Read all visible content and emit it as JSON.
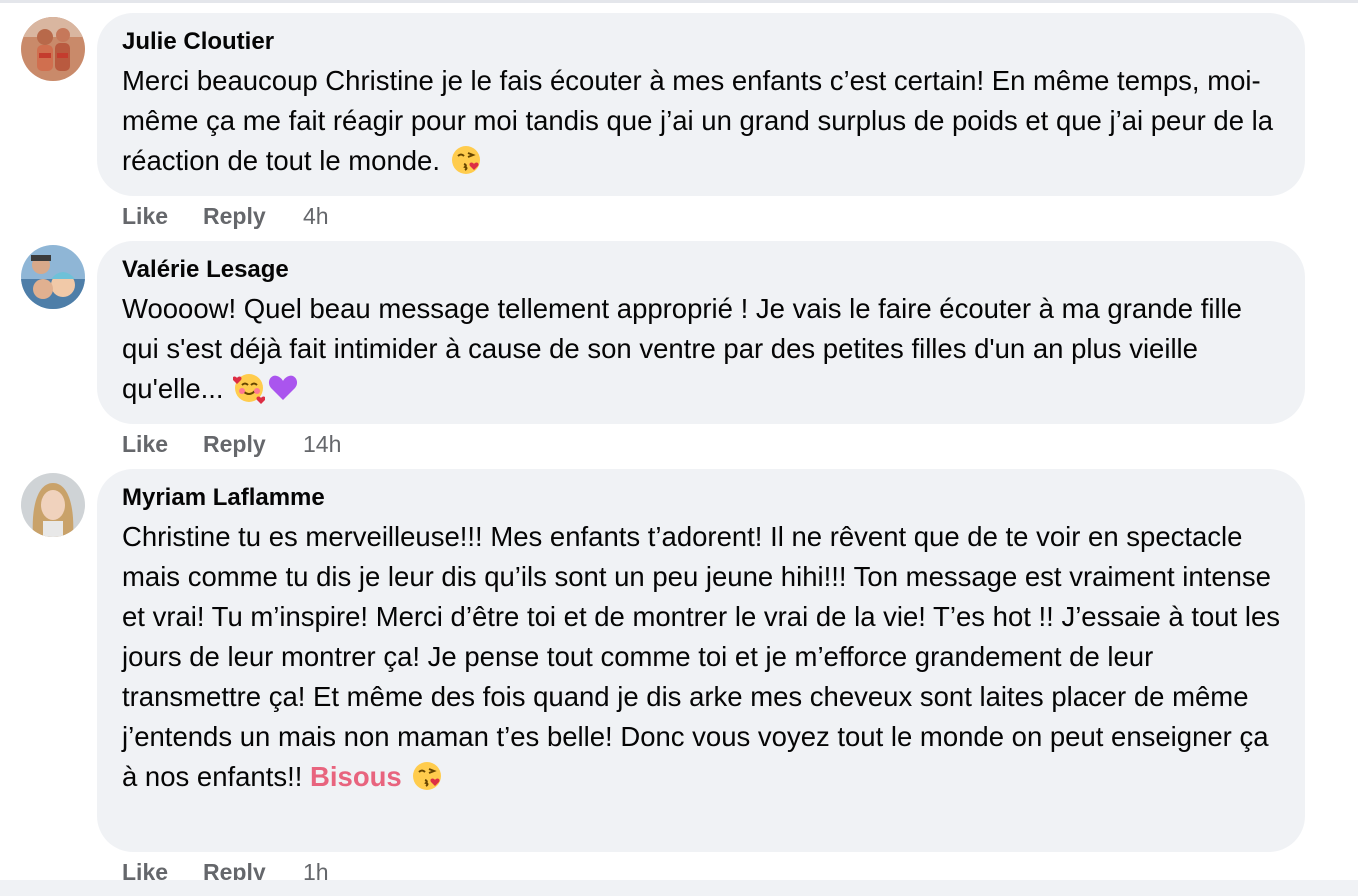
{
  "comments": [
    {
      "author": "Julie Cloutier",
      "text": "Merci beaucoup Christine je le fais écouter à mes enfants c’est certain! En même temps, moi-même ça me fait réagir pour moi tandis que j’ai un grand surplus de poids et que j’ai peur de la réaction de tout le monde.",
      "emojis": [
        "kissing-heart-emoji"
      ],
      "like_label": "Like",
      "reply_label": "Reply",
      "time": "4h"
    },
    {
      "author": "Valérie Lesage",
      "text": "Woooow! Quel beau message tellement approprié ! Je vais le faire écouter à ma grande fille qui s'est déjà fait intimider à cause de son ventre par des petites filles d'un an plus vieille qu'elle...",
      "emojis": [
        "smiling-hearts-emoji",
        "purple-heart-emoji"
      ],
      "like_label": "Like",
      "reply_label": "Reply",
      "time": "14h"
    },
    {
      "author": "Myriam Laflamme",
      "text": "Christine tu es merveilleuse!!! Mes enfants t’adorent! Il ne rêvent que de te voir en spectacle mais comme tu dis je leur dis qu’ils sont un peu jeune hihi!!! Ton message est vraiment intense et vrai! Tu m’inspire! Merci d’être toi et de montrer le vrai de la vie! T’es hot !! J’essaie à tout les jours de leur montrer ça! Je pense tout comme toi et je m’efforce grandement de leur transmettre ça! Et même des fois quand je dis arke mes cheveux sont laites placer de même j’entends un mais non maman t’es belle! Donc vous voyez tout le monde on peut enseigner ça à nos enfants!!",
      "mention": "Bisous",
      "emojis": [
        "kissing-heart-emoji"
      ],
      "like_label": "Like",
      "reply_label": "Reply",
      "time": "1h"
    }
  ],
  "colors": {
    "bubble_bg": "#f0f2f5",
    "meta_text": "#65676b",
    "mention": "#e8647e"
  }
}
